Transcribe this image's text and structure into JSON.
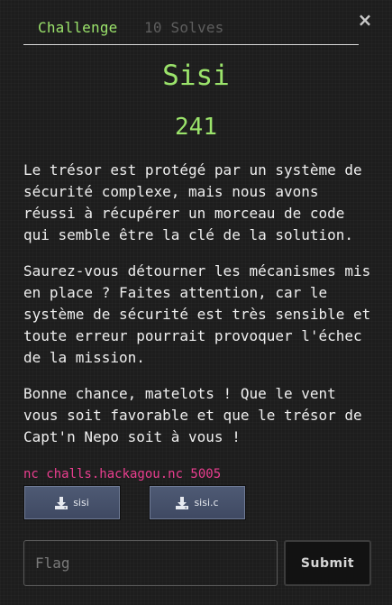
{
  "modal": {
    "tabs": [
      {
        "label": "Challenge",
        "active": true
      },
      {
        "label": "10 Solves",
        "active": false
      }
    ],
    "close_symbol": "×",
    "challenge": {
      "name": "Sisi",
      "points": "241",
      "description": [
        "Le trésor est protégé par un système de sécurité complexe, mais nous avons réussi à récupérer un morceau de code qui semble être la clé de la solution.",
        "Saurez-vous détourner les mécanismes mis en place ? Faites attention, car le système de sécurité est très sensible et toute erreur pourrait provoquer l'échec de la mission.",
        "Bonne chance, matelots ! Que le vent vous soit favorable et que le trésor de Capt'n Nepo soit à vous !"
      ],
      "connection_info": "nc challs.hackagou.nc 5005",
      "files": [
        {
          "name": "sisi",
          "icon": "download-icon"
        },
        {
          "name": "sisi.c",
          "icon": "download-icon"
        }
      ]
    },
    "flag_input": {
      "value": "",
      "placeholder": "Flag"
    },
    "submit_label": "Submit"
  },
  "colors": {
    "background": "#1d1d1d",
    "accent_green": "#9be36b",
    "connection_pink": "#ea3e8f",
    "file_button": "#4a5570"
  }
}
